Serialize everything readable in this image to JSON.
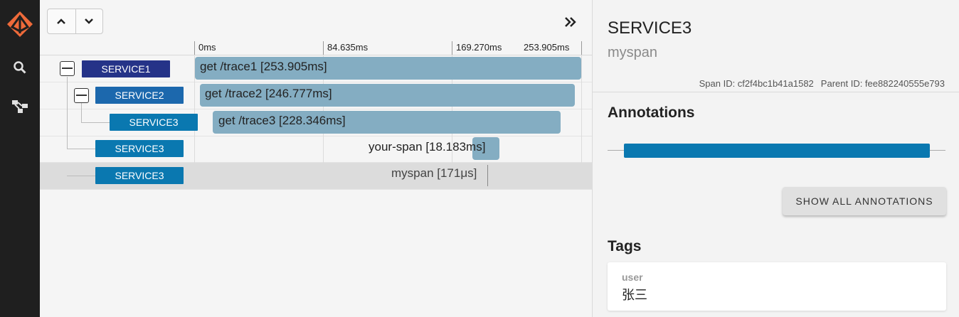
{
  "sidebar": {
    "logo_color": "#ee6a3a",
    "items": [
      {
        "icon": "search-icon"
      },
      {
        "icon": "dependency-graph-icon"
      }
    ]
  },
  "toolbar": {
    "nav_up_icon": "chevron-up-icon",
    "nav_down_icon": "chevron-down-icon",
    "expand_icon": "double-chevron-right-icon"
  },
  "timeline": {
    "ticks": [
      "0ms",
      "84.635ms",
      "169.270ms",
      "253.905ms"
    ],
    "spans": [
      {
        "service": "SERVICE1",
        "label": "get /trace1 [253.905ms]",
        "collapsible": true
      },
      {
        "service": "SERVICE2",
        "label": "get /trace2 [246.777ms]",
        "collapsible": true
      },
      {
        "service": "SERVICE3",
        "label": "get /trace3 [228.346ms]",
        "collapsible": false
      },
      {
        "service": "SERVICE3",
        "label": "your-span [18.183ms]",
        "collapsible": false
      },
      {
        "service": "SERVICE3",
        "label": "myspan [171μs]",
        "collapsible": false,
        "selected": true
      }
    ]
  },
  "detail": {
    "service": "SERVICE3",
    "span_name": "myspan",
    "span_id": "Span ID: cf2f4bc1b41a1582",
    "parent_id": "Parent ID: fee882240555e793",
    "annotations_heading": "Annotations",
    "show_all_label": "SHOW ALL ANNOTATIONS",
    "tags_heading": "Tags",
    "tags": [
      {
        "key": "user",
        "value": "张三"
      }
    ]
  },
  "colors": {
    "service_bar": "#0a78b0",
    "span_bar": "#84adc2",
    "root_service": "#253388"
  }
}
